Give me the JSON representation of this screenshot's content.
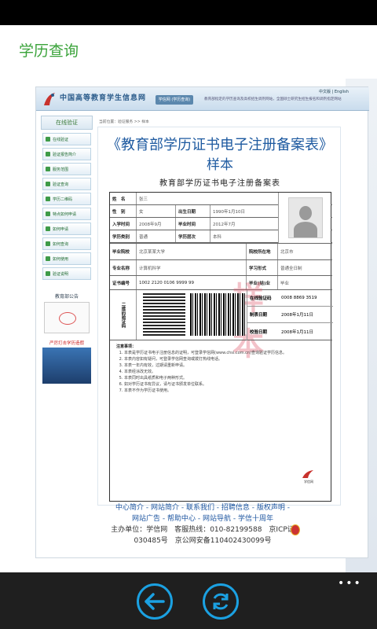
{
  "app": {
    "title": "学历查询"
  },
  "site": {
    "name": "中国高等教育学生信息网",
    "header_button": "学信网 (学历查询)",
    "header_note": "教育部指定的学历查询及高校招生调剂网站，全国硕士研究生招生报名和调剂指定网站",
    "lang": "中文版 | English",
    "breadcrumb": "当前位置：验证服务 >> 样本"
  },
  "sidebar": {
    "header": "在线验证",
    "items": [
      {
        "label": "在线验证"
      },
      {
        "label": "验证报告简介"
      },
      {
        "label": "服务范围"
      },
      {
        "label": "验证查询"
      },
      {
        "label": "学历二维码"
      },
      {
        "label": "特点如何申请"
      },
      {
        "label": "如何申请"
      },
      {
        "label": "如何查询"
      },
      {
        "label": "如何使用"
      },
      {
        "label": "验证说明"
      }
    ],
    "notice_title": "教育部公告",
    "promo_title": "严厉打击学历造假"
  },
  "document": {
    "title_line1": "《教育部学历证书电子注册备案表》",
    "title_line2": "样本",
    "form_title": "教育部学历证书电子注册备案表",
    "watermark": "样 本",
    "rows": {
      "name_label": "姓　名",
      "name_value": "张三",
      "gender_label": "性　别",
      "gender_value": "女",
      "birth_label": "出生日期",
      "birth_value": "1990年1月10日",
      "enroll_label": "入学时间",
      "enroll_value": "2008年9月",
      "grad_label": "毕业时间",
      "grad_value": "2012年7月",
      "type_label": "学历类别",
      "type_value": "普通",
      "form_label": "学历层次",
      "form_value": "本科",
      "school_label": "毕业院校",
      "school_value": "北京某某大学",
      "school_code_label": "院校所在地",
      "school_code_value": "北京市",
      "major_label": "专业名称",
      "major_value": "计算机科学",
      "study_label": "学习形式",
      "study_value": "普通全日制",
      "cert_label": "证书编号",
      "cert_value": "1002 2120 0106 9999 99",
      "result_label": "毕业(结)业",
      "result_value": "毕业",
      "qr_label": "二维码验证码",
      "online_label": "在线验证码",
      "online_value": "0008 8869 3519",
      "make_label": "制表日期",
      "make_value": "2008年1月11日",
      "check_label": "校验日期",
      "check_value": "2008年1月11日"
    },
    "notes_title": "注意事项：",
    "notes": [
      "本表是学历证书电子注册信息的证明，可登录学信网(www.chsi.com.cn)查询验证学历信息。",
      "本表内容如有疑问，可登录学信网查询或拨打热线电话。",
      "本表一年内有效，过期请重新申请。",
      "本表经涂改无效。",
      "本表同时出具纸质和电子两种形式。",
      "如对学历证书有异议，请与证书颁发单位联系。",
      "本表不作为学历证书使用。"
    ],
    "stamp": "学信网"
  },
  "footer": {
    "line1": "中心简介 - 网站简介 - 联系我们 - 招聘信息 - 版权声明 -",
    "line2": "网站广告 - 帮助中心 - 网站导航 - 学信十周年",
    "line3": "主办单位：学信网　客服热线：010-82199588　京ICP证",
    "line4": "030485号　京公网安备11040243009​9号"
  },
  "appbar": {
    "back_icon": "back-arrow-icon",
    "refresh_icon": "refresh-icon",
    "more": "•••"
  }
}
